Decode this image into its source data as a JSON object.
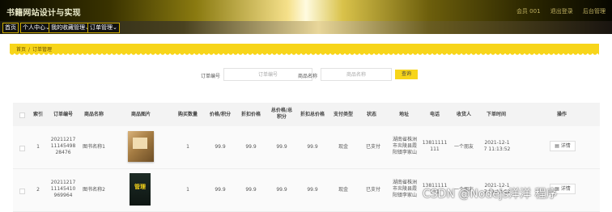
{
  "header": {
    "title": "书籍网站设计与实现",
    "user_label": "会员 001",
    "logout_label": "退出登录",
    "admin_label": "后台管理"
  },
  "nav": [
    {
      "label": "首页"
    },
    {
      "label": "个人中心"
    },
    {
      "label": "我的收藏管理"
    },
    {
      "label": "订单管理"
    }
  ],
  "breadcrumb": {
    "home": "首页",
    "separator": "/",
    "current": "订单管理"
  },
  "search": {
    "order_label": "订单编号",
    "order_placeholder": "订单编号",
    "product_label": "商品名称",
    "product_placeholder": "商品名称",
    "query_button": "查询"
  },
  "table": {
    "headers": [
      "索引",
      "订单编号",
      "商品名称",
      "商品图片",
      "购买数量",
      "价格/积分",
      "折扣价格",
      "总价格/总积分",
      "折扣总价格",
      "支付类型",
      "状态",
      "地址",
      "电话",
      "收货人",
      "下单时间",
      "操作"
    ],
    "rows": [
      {
        "index": "1",
        "order_no": "20211217111454982847 6",
        "order_no_lines": [
          "20211217",
          "11145498",
          "28476"
        ],
        "name": "图书名称1",
        "cover_text": "",
        "qty": "1",
        "price": "99.9",
        "discount": "99.9",
        "total": "99.9",
        "discount_total": "99.9",
        "pay": "现金",
        "status": "已支付",
        "address_lines": [
          "湖南省株洲",
          "市炎陵县霞",
          "阳镇李家山"
        ],
        "phone_lines": [
          "13811111",
          "111"
        ],
        "receiver": "一个朋友",
        "time_lines": [
          "2021-12-1",
          "7 11:13:52"
        ],
        "action": "详情"
      },
      {
        "index": "2",
        "order_no_lines": [
          "20211217",
          "11145410",
          "969964"
        ],
        "name": "图书名称2",
        "cover_text": "管理",
        "qty": "1",
        "price": "99.9",
        "discount": "99.9",
        "total": "99.9",
        "discount_total": "99.9",
        "pay": "现金",
        "status": "已支付",
        "address_lines": [
          "湖南省株洲",
          "市炎陵县霞",
          "阳镇李家山"
        ],
        "phone_lines": [
          "13811111",
          "111"
        ],
        "receiver": "一个朋友",
        "time_lines": [
          "2021-12-1",
          "7 11:13:52"
        ],
        "action": "详情"
      }
    ]
  },
  "watermark": "CSDN @Nodejs洋洋  程序"
}
